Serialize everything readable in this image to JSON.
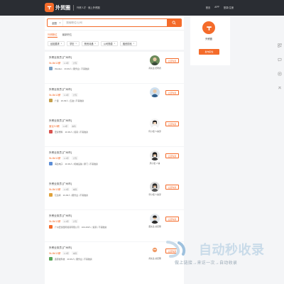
{
  "header": {
    "brand": "外贸圈",
    "slogan": "外贸人才 · 就上外贸圈",
    "nav": [
      "首页",
      "APP",
      "登录/注册"
    ]
  },
  "search": {
    "scope": "全国",
    "placeholder": "搜索职位/公司"
  },
  "tabs": [
    {
      "label": "外贸职位",
      "active": true
    },
    {
      "label": "最新职位",
      "active": false
    }
  ],
  "filters": [
    "经验要求",
    "学历",
    "薪资待遇",
    "公司规模",
    "融资阶段"
  ],
  "jobs": [
    {
      "title": "外贸业务员 [广州市]",
      "salary": "5k-8k/12薪",
      "tags": [
        "1-3年",
        "大专"
      ],
      "company": "Weidian",
      "company_info": "20-99人 | 服务业 | 不需融资",
      "recruiter": "黄先生 招聘者",
      "chat": "立即沟通",
      "logo_color": "#7aa0c4"
    },
    {
      "title": "外贸业务员 [广州市]",
      "salary": "5k-8k/12薪",
      "tags": [
        "1-3年",
        "大专"
      ],
      "company": "广鑫",
      "company_info": "20-99人 | 五金 | 不需融资",
      "recruiter": "",
      "chat": "立即沟通",
      "logo_color": "#c5a04d"
    },
    {
      "title": "外贸业务员 [广州市]",
      "salary": "面议/13薪",
      "tags": [
        "1-3年",
        "本科"
      ],
      "company": "宏泰塑料",
      "company_info": "20-99人 | 贸易 | 不需融资",
      "recruiter": "何小姐 人事部",
      "chat": "立即沟通",
      "logo_color": "#d9534f"
    },
    {
      "title": "外贸业务员 [广州市]",
      "salary": "5k-8k/12薪",
      "tags": [
        "1-3年",
        "大专"
      ],
      "company": "海达电子",
      "company_info": "20-99人 | 机械设备 | 厦门 | 不需融资",
      "recruiter": "周小姐 人事",
      "chat": "立即沟通",
      "logo_color": "#5b8dd6"
    },
    {
      "title": "外贸业务员 [广州市]",
      "salary": "5k-8k/12薪",
      "tags": [
        "1-3年",
        "本科"
      ],
      "company": "亿达商",
      "company_info": "20-99人 | 服务业 | 不需融资",
      "recruiter": "郭小姐 人事部",
      "chat": "立即沟通",
      "logo_color": "#e0a23a"
    },
    {
      "title": "外贸业务员 [广州市]",
      "salary": "5k-8k/12薪",
      "tags": [
        "1-3年",
        "大专"
      ],
      "company": "广州宏泰国际贸易有限公司",
      "company_info": "100-499人 | 贸易 | 不需融资",
      "recruiter": "董先生 总经理",
      "chat": "立即沟通",
      "logo_color": "#f46b2a"
    },
    {
      "title": "外贸业务员 [广州市]",
      "salary": "5k-8k/12薪",
      "tags": [
        "1-3年",
        "本科"
      ],
      "company": "鑫源发科技",
      "company_info": "20-99人 | 服务业 | 不需融资",
      "recruiter": "黄先生 总经理",
      "chat": "立即沟通",
      "logo_color": "#5aa65a"
    }
  ],
  "sidebar": {
    "brand": "外贸圈",
    "button": "发布职位"
  },
  "toolbar": [
    "qr-code-icon",
    "chat-icon",
    "feedback-icon",
    "top-icon"
  ],
  "watermark": {
    "text": "自动秒收录",
    "sub": "做上链接→来访一次→自动收录"
  }
}
